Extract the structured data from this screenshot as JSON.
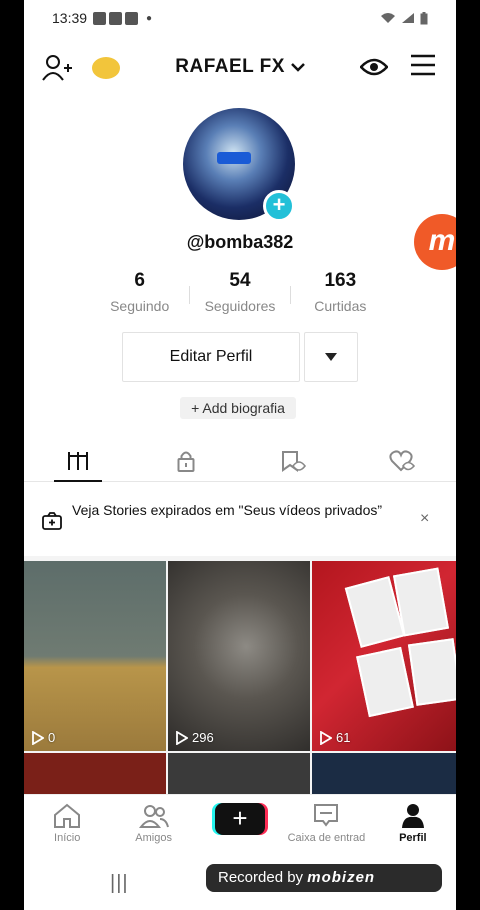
{
  "status_bar": {
    "time": "13:39"
  },
  "header": {
    "username": "RAFAEL  FX"
  },
  "profile": {
    "handle": "@bomba382",
    "avatar_plus": "+"
  },
  "stats": [
    {
      "value": "6",
      "label": "Seguindo"
    },
    {
      "value": "54",
      "label": "Seguidores"
    },
    {
      "value": "163",
      "label": "Curtidas"
    }
  ],
  "actions": {
    "edit_profile": "Editar Perfil",
    "add_bio": "+ Add biografia"
  },
  "tabs": [
    "videos-grid-icon",
    "lock-icon",
    "bookmark-icon",
    "liked-icon"
  ],
  "banner": {
    "text": "Veja Stories expirados em \"Seus vídeos privados”",
    "close": "×"
  },
  "videos": [
    {
      "views": "0"
    },
    {
      "views": "296"
    },
    {
      "views": "61"
    }
  ],
  "bottom_nav": [
    {
      "label": "Início"
    },
    {
      "label": "Amigos"
    },
    {
      "label": ""
    },
    {
      "label": "Caixa de entrad"
    },
    {
      "label": "Perfil"
    }
  ],
  "overlay": {
    "mobizen_letter": "m",
    "recorded_by": "Recorded by",
    "recorded_brand": "mobizen"
  },
  "colors": {
    "accent_cyan": "#25f4ee",
    "accent_red": "#fe2c55",
    "mobizen": "#f05a28"
  }
}
